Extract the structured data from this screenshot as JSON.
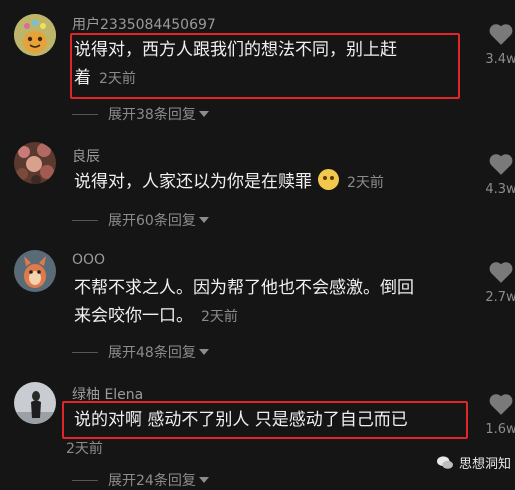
{
  "comments": [
    {
      "username": "用户2335084450697",
      "text_lines": [
        "说得对，西方人跟我们的想法不同，别上赶",
        "着"
      ],
      "time": "2天前",
      "replies": "展开38条回复",
      "likes": "3.4w",
      "highlighted": true
    },
    {
      "username": "良辰",
      "text_lines": [
        "说得对，人家还以为你是在赎罪"
      ],
      "time": "2天前",
      "replies": "展开60条回复",
      "likes": "4.3w",
      "highlighted": false
    },
    {
      "username": "OOO",
      "text_lines": [
        "不帮不求之人。因为帮了他也不会感激。倒回",
        "来会咬你一口。"
      ],
      "time": "2天前",
      "replies": "展开48条回复",
      "likes": "2.7w",
      "highlighted": false
    },
    {
      "username": "绿柚 Elena",
      "text_lines": [
        "说的对啊 感动不了别人 只是感动了自己而已"
      ],
      "time": "2天前",
      "replies": "展开24条回复",
      "likes": "1.6w",
      "highlighted": true
    }
  ],
  "watermark": "思想洞知",
  "colors": {
    "highlight": "#e0262a",
    "background": "#151515"
  }
}
